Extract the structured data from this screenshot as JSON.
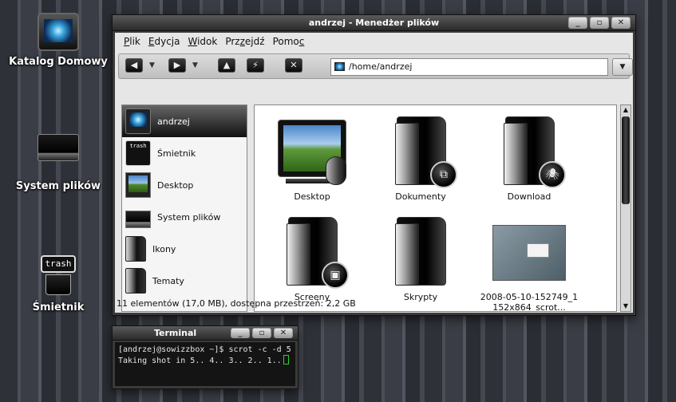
{
  "desktop": {
    "icons": [
      {
        "label": "Katalog Domowy",
        "icon": "home-monitor-icon"
      },
      {
        "label": "System plików",
        "icon": "hard-drive-icon"
      },
      {
        "label": "Śmietnik",
        "icon": "trash-icon",
        "badge": "trash"
      }
    ]
  },
  "file_manager": {
    "title": "andrzej - Menedżer plików",
    "window_buttons": [
      "_",
      "▫",
      "✕"
    ],
    "menu": [
      {
        "label": "Plik",
        "mnemonic": "P"
      },
      {
        "label": "Edycja",
        "mnemonic": "E"
      },
      {
        "label": "Widok",
        "mnemonic": "W"
      },
      {
        "label": "Przejdź",
        "mnemonic": "z"
      },
      {
        "label": "Pomoc",
        "mnemonic": "c"
      }
    ],
    "toolbar": {
      "back": "◀",
      "forward": "▶",
      "up": "▲",
      "reload": "⚡",
      "home": "✕",
      "dropdown": "▼"
    },
    "location": "/home/andrzej",
    "location_dropdown": "▼",
    "sidebar": [
      {
        "label": "andrzej",
        "icon": "home-monitor-icon",
        "selected": true
      },
      {
        "label": "Śmietnik",
        "icon": "trash-icon",
        "badge": "trash"
      },
      {
        "label": "Desktop",
        "icon": "desktop-icon"
      },
      {
        "label": "System plików",
        "icon": "hard-drive-icon"
      },
      {
        "label": "Ikony",
        "icon": "folder-icon"
      },
      {
        "label": "Tematy",
        "icon": "folder-icon"
      }
    ],
    "files": [
      {
        "name": "Desktop",
        "icon": "desktop-icon"
      },
      {
        "name": "Dokumenty",
        "icon": "folder-documents-icon",
        "emblem": "⧉"
      },
      {
        "name": "Download",
        "icon": "folder-download-icon",
        "emblem": "🕷"
      },
      {
        "name": "Screeny",
        "icon": "folder-pictures-icon",
        "emblem": "▣"
      },
      {
        "name": "Skrypty",
        "icon": "folder-icon"
      },
      {
        "name": "2008-05-10-152749_1 152x864_scrot...",
        "icon": "screenshot-thumbnail"
      }
    ],
    "status": "11 elementów (17,0 MB), dostępna przestrzeń: 2,2 GB",
    "scrollbar": {
      "up": "▲",
      "down": "▼"
    }
  },
  "terminal": {
    "title": "Terminal",
    "window_buttons": [
      "_",
      "▫",
      "✕"
    ],
    "lines": [
      "[andrzej@sowizzbox ~]$ scrot -c -d 5",
      "Taking shot in 5.. 4.. 3.. 2.. 1.."
    ]
  }
}
